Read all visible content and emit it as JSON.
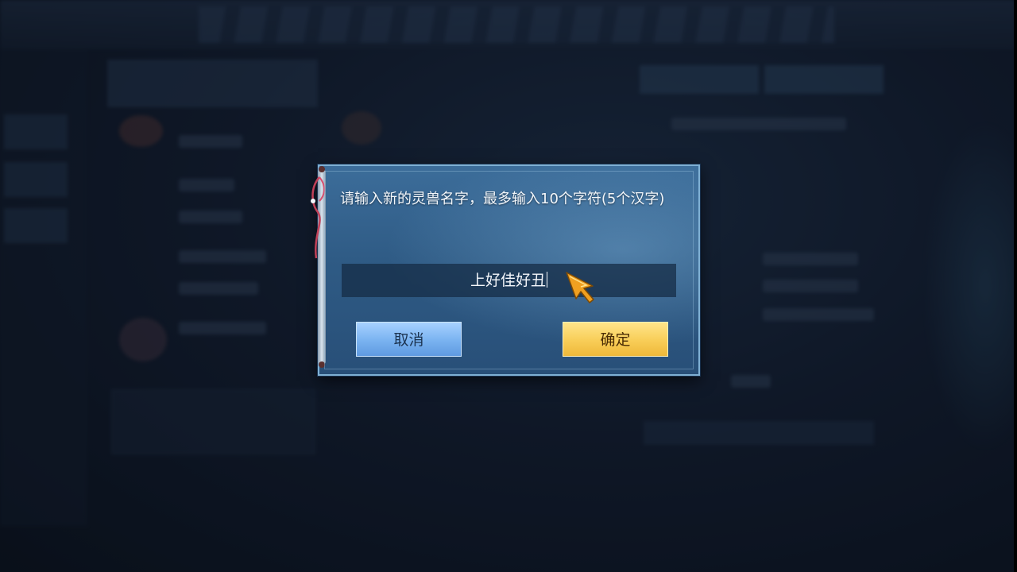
{
  "dialog": {
    "message": "请输入新的灵兽名字，最多输入10个字符(5个汉字)",
    "input_value": "上好佳好丑",
    "cancel_label": "取消",
    "confirm_label": "确定"
  },
  "colors": {
    "dialog_bg": "#2f5b85",
    "cancel_button": "#79b2f0",
    "confirm_button": "#f8cd57",
    "cursor": "#f0a020"
  },
  "icons": {
    "cursor": "arrow-cursor-icon",
    "ribbon": "ribbon-icon"
  }
}
